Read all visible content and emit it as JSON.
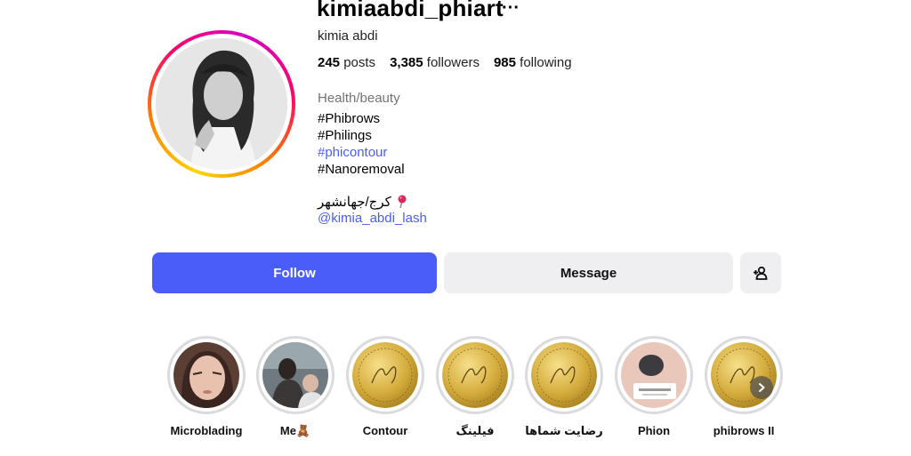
{
  "profile": {
    "username": "kimiaabdi_phiart",
    "more_label": "···",
    "full_name": "kimia abdi",
    "stats": {
      "posts_count": "245",
      "posts_label": "posts",
      "followers_count": "3,385",
      "followers_label": "followers",
      "following_count": "985",
      "following_label": "following"
    },
    "category": "Health/beauty",
    "bio_lines": [
      "#Phibrows",
      "#Philings",
      "#phicontour",
      "#Nanoremoval"
    ],
    "location": "کرج/جهانشهر",
    "location_icon": "pin-icon",
    "link_handle": "@kimia_abdi_lash"
  },
  "actions": {
    "follow_label": "Follow",
    "message_label": "Message",
    "add_user_icon": "add-user-icon"
  },
  "highlights": [
    {
      "label": "Microblading",
      "image": "face-portrait"
    },
    {
      "label": "Me🧸",
      "image": "salon-photo"
    },
    {
      "label": "Contour",
      "image": "gold-coin-logo"
    },
    {
      "label": "فیلینگ",
      "image": "gold-coin-logo"
    },
    {
      "label": "رضایت شماها",
      "image": "gold-coin-logo"
    },
    {
      "label": "Phion",
      "image": "phion-device-photo"
    },
    {
      "label": "phibrows II",
      "image": "gold-coin-logo"
    }
  ],
  "colors": {
    "accent": "#4a5df9",
    "button_secondary": "#efeff2",
    "muted_text": "#737373",
    "link": "#4a5df9"
  }
}
